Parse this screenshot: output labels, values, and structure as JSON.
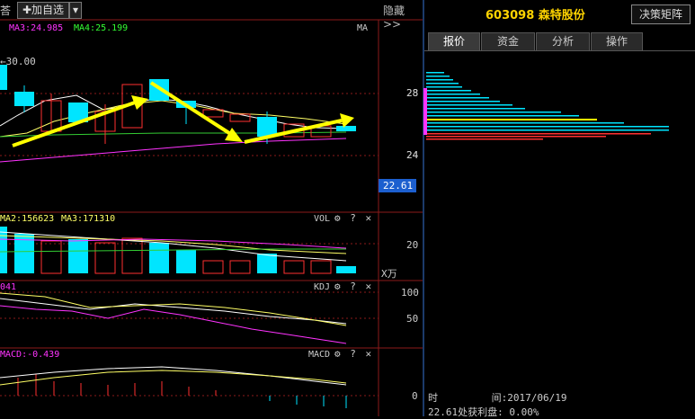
{
  "toolbar": {
    "left_fragment": "荅",
    "add_watchlist": "✚加自选",
    "dropdown": "▾",
    "hide": "隐藏>>"
  },
  "main_chart": {
    "ma3_label": "MA3:24.985",
    "ma4_label": "MA4:25.199",
    "ma_tag": "MA",
    "price_marker": "←30.00",
    "ytick_28": "28",
    "ytick_24": "24",
    "current_price": "22.61",
    "colors": {
      "up": "#ff3030",
      "down": "#00e5ff",
      "arrow": "#ffff00",
      "ma_white": "#ffffff",
      "ma_yellow": "#ffff66",
      "ma_green": "#33cc33",
      "ma_magenta": "#ff33ff"
    }
  },
  "vol_panel": {
    "ma2_label": "MA2:156623",
    "ma3_label": "MA3:171310",
    "name": "VOL",
    "ytick": "20",
    "unit": "X万"
  },
  "kdj_panel": {
    "value_label": "041",
    "name": "KDJ",
    "ytick_100": "100",
    "ytick_50": "50"
  },
  "macd_panel": {
    "value_label": "MACD:-0.439",
    "name": "MACD",
    "ytick_0": "0"
  },
  "panel_icons": {
    "gear": "⚙",
    "help": "?",
    "close": "✕"
  },
  "right_panel": {
    "code_name": "603098 森特股份",
    "matrix_button": "决策矩阵",
    "tabs": [
      "报价",
      "资金",
      "分析",
      "操作"
    ],
    "active_tab": 0,
    "ytick_28": "28",
    "ytick_24": "24",
    "time_label": "时         间:2017/06/19",
    "profit_label": "22.61处获利盘: 0.00%"
  }
}
